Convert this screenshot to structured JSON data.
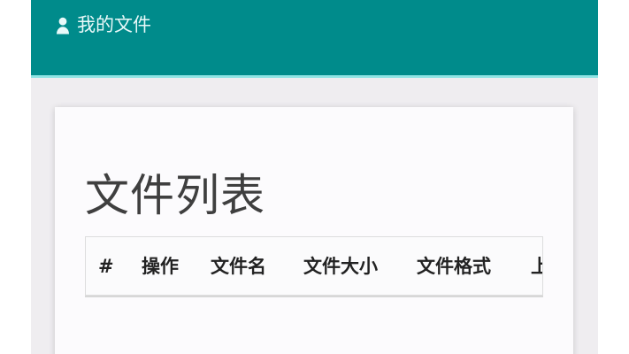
{
  "header": {
    "title": "我的文件",
    "icon": "user-icon",
    "bg_color": "#008b8b"
  },
  "main": {
    "card_title": "文件列表",
    "table": {
      "columns": [
        "#",
        "操作",
        "文件名",
        "文件大小",
        "文件格式",
        "上"
      ]
    }
  }
}
